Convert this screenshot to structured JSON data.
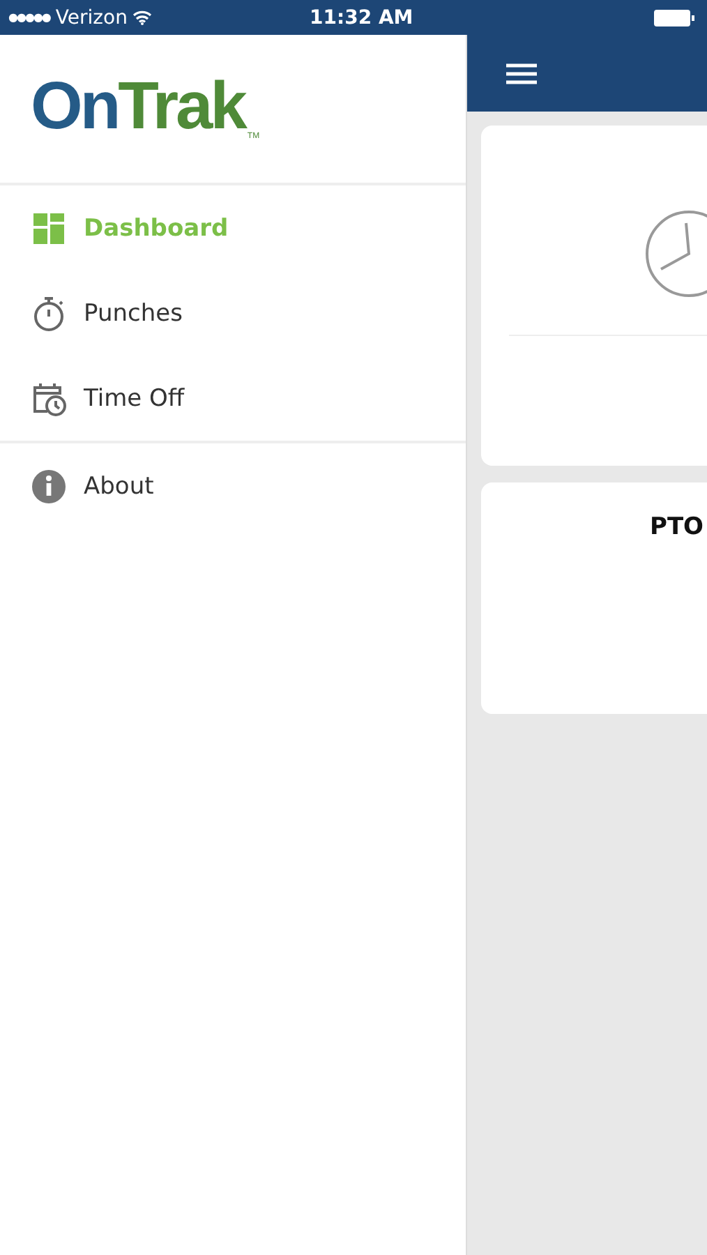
{
  "status_bar": {
    "signal_dots": "●●●●●",
    "carrier": "Verizon",
    "time": "11:32 AM"
  },
  "logo": {
    "first": "On",
    "second": "Trak",
    "mark": "TM"
  },
  "menu_sections": [
    [
      {
        "label": "Dashboard",
        "kind": "dashboard",
        "selected": true
      },
      {
        "label": "Punches",
        "kind": "stopwatch",
        "selected": false
      },
      {
        "label": "Time Off",
        "kind": "calendar",
        "selected": false
      }
    ],
    [
      {
        "label": "About",
        "kind": "info",
        "selected": false
      }
    ]
  ],
  "cards": [
    {
      "kind": "clock"
    },
    {
      "kind": "title",
      "title": "PTO"
    }
  ]
}
